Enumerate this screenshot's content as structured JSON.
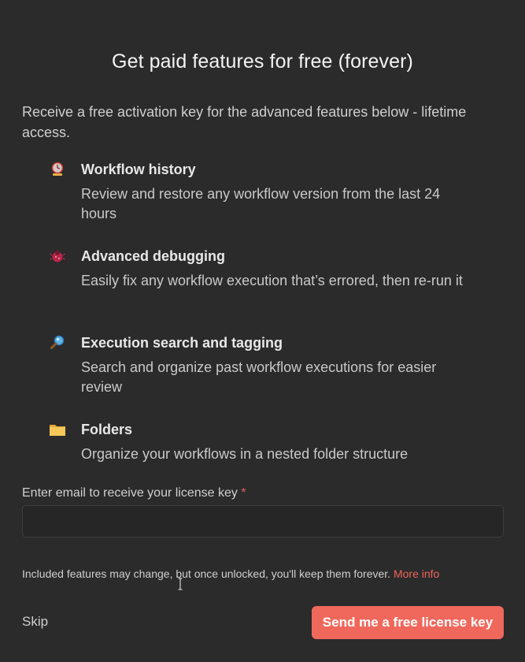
{
  "modal": {
    "title": "Get paid features for free (forever)",
    "intro": "Receive a free activation key for the advanced features below - lifetime access."
  },
  "features": [
    {
      "icon": "clock-icon",
      "title": "Workflow history",
      "description": "Review and restore any workflow version from the last 24 hours"
    },
    {
      "icon": "bug-icon",
      "title": "Advanced debugging",
      "description": "Easily fix any workflow execution that’s errored, then re-run it"
    },
    {
      "icon": "magnifier-icon",
      "title": "Execution search and tagging",
      "description": "Search and organize past workflow executions for easier review"
    },
    {
      "icon": "folder-icon",
      "title": "Folders",
      "description": "Organize your workflows in a nested folder structure"
    }
  ],
  "email": {
    "label": "Enter email to receive your license key",
    "required_marker": "*",
    "value": "",
    "placeholder": ""
  },
  "footer": {
    "note": "Included features may change, but once unlocked, you'll keep them forever.",
    "more_info_label": "More info",
    "skip_label": "Skip",
    "submit_label": "Send me a free license key"
  },
  "colors": {
    "background": "#2b2b2b",
    "accent": "#f0685c",
    "required": "#e35d5d"
  }
}
